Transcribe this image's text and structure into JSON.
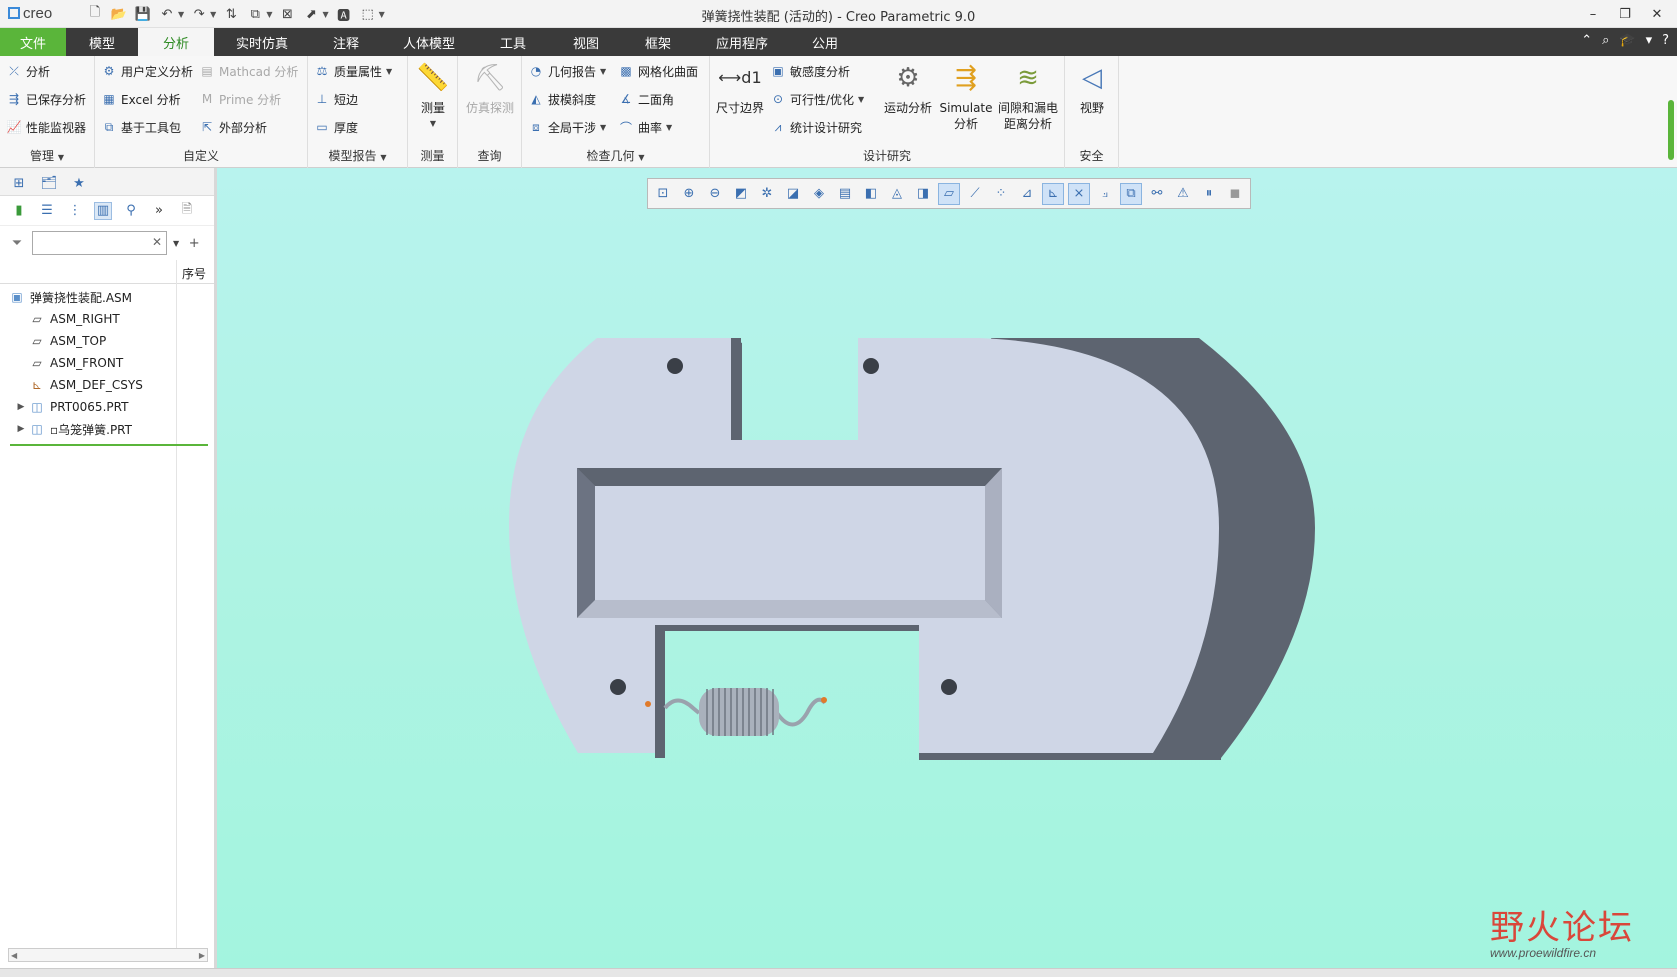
{
  "app": {
    "logo": "creo",
    "window_title": "弹簧挠性装配 (活动的) - Creo Parametric 9.0"
  },
  "menu": {
    "tabs": [
      "文件",
      "模型",
      "分析",
      "实时仿真",
      "注释",
      "人体模型",
      "工具",
      "视图",
      "框架",
      "应用程序",
      "公用"
    ],
    "active": "分析"
  },
  "ribbon": {
    "manage": {
      "label": "管理",
      "items": [
        "分析",
        "已保存分析",
        "性能监视器"
      ]
    },
    "custom": {
      "label": "自定义",
      "items": [
        "用户定义分析",
        "Excel 分析",
        "基于工具包",
        "Mathcad 分析",
        "Prime 分析",
        "外部分析"
      ]
    },
    "model_report": {
      "label": "模型报告",
      "items": [
        "质量属性",
        "短边",
        "厚度"
      ]
    },
    "measure": {
      "label": "测量",
      "button": "测量"
    },
    "query": {
      "label": "查询",
      "button": "仿真探测"
    },
    "inspect": {
      "label": "检查几何",
      "items": [
        "几何报告",
        "拔模斜度",
        "全局干涉",
        "网格化曲面",
        "二面角",
        "曲率"
      ]
    },
    "design_study": {
      "label": "设计研究",
      "items": [
        "尺寸边界",
        "敏感度分析",
        "可行性/优化",
        "统计设计研究",
        "运动分析",
        "Simulate",
        "分析",
        "间隙和漏电",
        "距离分析"
      ]
    },
    "safety": {
      "label": "安全",
      "button": "视野"
    }
  },
  "model_tree": {
    "column_header": "序号",
    "search_placeholder": "",
    "items": [
      {
        "name": "弹簧挠性装配.ASM",
        "icon": "assembly-icon",
        "level": 0
      },
      {
        "name": "ASM_RIGHT",
        "icon": "datum-plane-icon",
        "level": 1
      },
      {
        "name": "ASM_TOP",
        "icon": "datum-plane-icon",
        "level": 1
      },
      {
        "name": "ASM_FRONT",
        "icon": "datum-plane-icon",
        "level": 1
      },
      {
        "name": "ASM_DEF_CSYS",
        "icon": "csys-icon",
        "level": 1
      },
      {
        "name": "PRT0065.PRT",
        "icon": "part-icon",
        "level": 1,
        "expandable": true
      },
      {
        "name": "▫乌笼弹簧.PRT",
        "icon": "part-icon",
        "level": 1,
        "expandable": true
      }
    ]
  },
  "watermark": {
    "title": "野火论坛",
    "url": "www.proewildfire.cn"
  },
  "colors": {
    "file_tab": "#5ab53a",
    "menubar": "#3a3a3a",
    "viewport_top": "#b8f3ee",
    "viewport_bottom": "#a3f4df",
    "part_face": "#cfd6e6",
    "part_edge": "#5d6470",
    "accent_green": "#2d8a22"
  }
}
